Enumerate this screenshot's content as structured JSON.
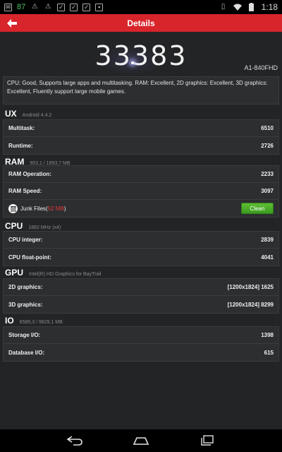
{
  "status_bar": {
    "notification_count": "87",
    "icons": [
      "warning-icon",
      "warning-icon",
      "checkbox-icon",
      "checkbox-icon",
      "checkbox-icon",
      "image-icon"
    ],
    "right_icons": [
      "vibrate-icon",
      "wifi-icon",
      "battery-icon"
    ],
    "time": "1:18"
  },
  "header": {
    "title": "Details",
    "back_icon": "back-arrow-icon",
    "color": "#d8252b"
  },
  "score": {
    "value": "33383",
    "device": "A1-840FHD"
  },
  "summary": "CPU: Good, Supports large apps and multitasking. RAM: Excellent, 2D graphics: Excellent, 3D graphics: Excellent, Fluently support large mobile games.",
  "sections": {
    "ux": {
      "title": "UX",
      "subtitle": "Android 4.4.2",
      "rows": [
        {
          "label": "Multitask:",
          "value": "6510"
        },
        {
          "label": "Runtime:",
          "value": "2726"
        }
      ]
    },
    "ram": {
      "title": "RAM",
      "subtitle": "953,1 / 1893,7 MB",
      "rows": [
        {
          "label": "RAM Operation:",
          "value": "2233"
        },
        {
          "label": "RAM Speed:",
          "value": "3097"
        }
      ],
      "junk": {
        "label": "Junk Files(",
        "size": "52 MB",
        "close": ")",
        "button": "Clean",
        "button_color": "#4aad28"
      }
    },
    "cpu": {
      "title": "CPU",
      "subtitle": "1862 MHz (x4)",
      "rows": [
        {
          "label": "CPU integer:",
          "value": "2839"
        },
        {
          "label": "CPU float-point:",
          "value": "4041"
        }
      ]
    },
    "gpu": {
      "title": "GPU",
      "subtitle": "Intel(R) HD Graphics for BayTrail",
      "rows": [
        {
          "label": "2D graphics:",
          "value": "[1200x1824] 1625"
        },
        {
          "label": "3D graphics:",
          "value": "[1200x1824] 8299"
        }
      ]
    },
    "io": {
      "title": "IO",
      "subtitle": "6589,3 / 9829,1 MB",
      "rows": [
        {
          "label": "Storage I/O:",
          "value": "1398"
        },
        {
          "label": "Database I/O:",
          "value": "615"
        }
      ]
    }
  },
  "nav_bar": [
    "back-icon",
    "home-icon",
    "recents-icon"
  ]
}
